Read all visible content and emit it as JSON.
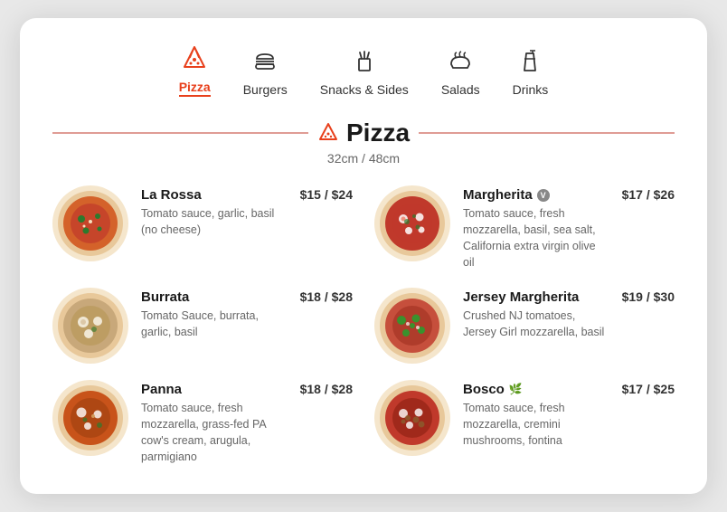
{
  "nav": {
    "items": [
      {
        "id": "pizza",
        "label": "Pizza",
        "active": true
      },
      {
        "id": "burgers",
        "label": "Burgers",
        "active": false
      },
      {
        "id": "snacks",
        "label": "Snacks & Sides",
        "active": false
      },
      {
        "id": "salads",
        "label": "Salads",
        "active": false
      },
      {
        "id": "drinks",
        "label": "Drinks",
        "active": false
      }
    ]
  },
  "section": {
    "title": "Pizza",
    "subtitle": "32cm / 48cm"
  },
  "menu": {
    "items": [
      {
        "id": "la-rossa",
        "name": "La Rossa",
        "description": "Tomato sauce, garlic, basil (no cheese)",
        "price": "$15 / $24",
        "badge": null,
        "side": "left",
        "pizza_color": "#c0392b",
        "pizza_bg": "#f9e0c8"
      },
      {
        "id": "margherita",
        "name": "Margherita",
        "description": "Tomato sauce, fresh mozzarella, basil, sea salt, California extra virgin olive oil",
        "price": "$17 / $26",
        "badge": "V",
        "side": "right",
        "pizza_color": "#e8401c",
        "pizza_bg": "#fde8d8"
      },
      {
        "id": "burrata",
        "name": "Burrata",
        "description": "Tomato Sauce, burrata, garlic, basil",
        "price": "$18 / $28",
        "badge": null,
        "side": "left",
        "pizza_color": "#8b6914",
        "pizza_bg": "#f0e6d0"
      },
      {
        "id": "jersey-margherita",
        "name": "Jersey Margherita",
        "description": "Crushed NJ tomatoes, Jersey Girl mozzarella, basil",
        "price": "$19 / $30",
        "badge": null,
        "side": "right",
        "pizza_color": "#2d7a2d",
        "pizza_bg": "#e8f5e0"
      },
      {
        "id": "panna",
        "name": "Panna",
        "description": "Tomato sauce, fresh mozzarella, grass-fed PA cow's cream, arugula, parmigiano",
        "price": "$18 / $28",
        "badge": null,
        "side": "left",
        "pizza_color": "#c0531a",
        "pizza_bg": "#fde8d0"
      },
      {
        "id": "bosco",
        "name": "Bosco",
        "description": "Tomato sauce, fresh mozzarella, cremini mushrooms, fontina",
        "price": "$17 / $25",
        "badge": "leaf",
        "side": "right",
        "pizza_color": "#a0522d",
        "pizza_bg": "#f5e0cc"
      }
    ]
  }
}
